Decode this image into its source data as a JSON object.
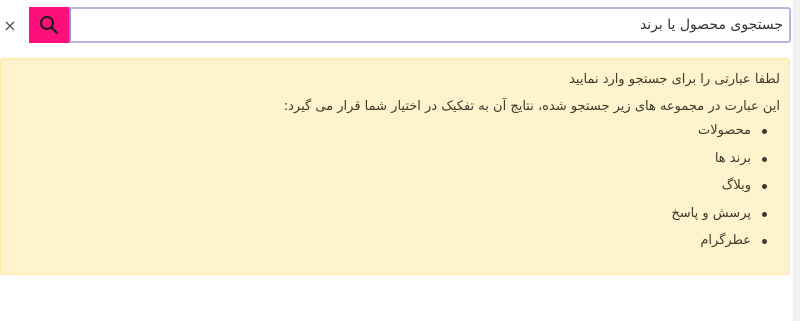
{
  "search": {
    "close_label": "×",
    "value": "جستجوی محصول یا برند",
    "search_icon": "magnifier-icon"
  },
  "alert": {
    "title": "لطفا عبارتی را برای جستجو وارد نمایید",
    "description": "این عبارت در مجموعه های زیر جستجو شده، نتایج آن به تفکیک در اختیار شما قرار می گیرد:",
    "items": [
      "محصولات",
      "برند ها",
      "وبلاگ",
      "پرسش و پاسخ",
      "عطرگرام"
    ]
  },
  "colors": {
    "search_button": "#ff0f7b",
    "alert_background": "#fff3cd",
    "input_border": "#b7b4e6"
  }
}
